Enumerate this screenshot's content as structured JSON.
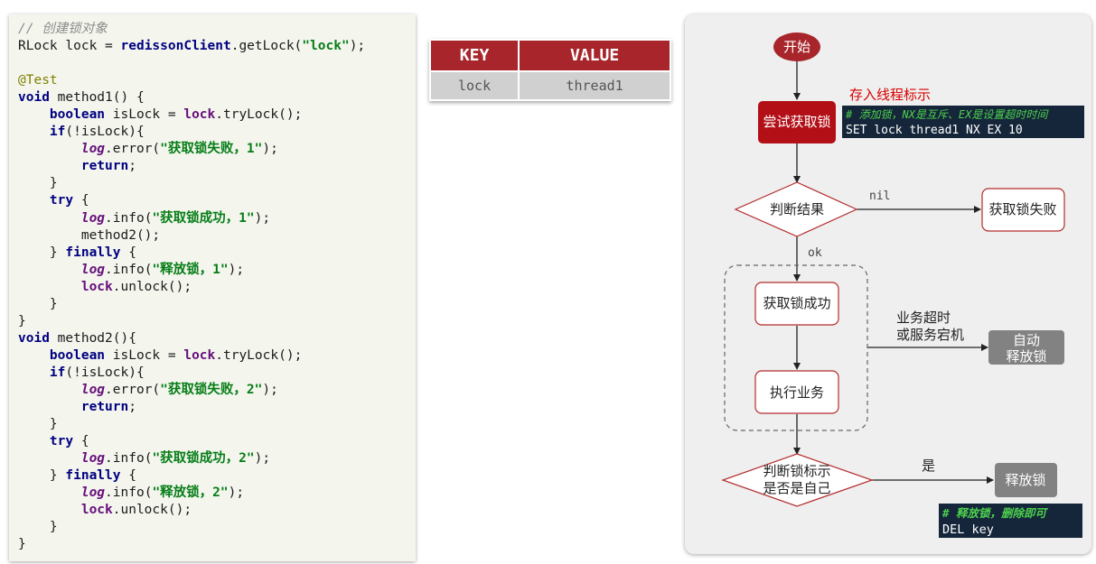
{
  "code": {
    "lines": [
      [
        [
          "// 创建锁对象",
          "comment"
        ]
      ],
      [
        [
          "RLock lock = ",
          "plain"
        ],
        [
          "redissonClient",
          "kw"
        ],
        [
          ".getLock(",
          "plain"
        ],
        [
          "\"lock\"",
          "str"
        ],
        [
          ");",
          "plain"
        ]
      ],
      [],
      [
        [
          "@Test",
          "ann"
        ]
      ],
      [
        [
          "void",
          "kw"
        ],
        [
          " method1() {",
          "plain"
        ]
      ],
      [
        [
          "    ",
          "plain"
        ],
        [
          "boolean",
          "kw"
        ],
        [
          " isLock = ",
          "plain"
        ],
        [
          "lock",
          "field"
        ],
        [
          ".tryLock();",
          "plain"
        ]
      ],
      [
        [
          "    ",
          "plain"
        ],
        [
          "if",
          "kw"
        ],
        [
          "(!isLock){",
          "plain"
        ]
      ],
      [
        [
          "        ",
          "plain"
        ],
        [
          "log",
          "static"
        ],
        [
          ".error(",
          "plain"
        ],
        [
          "\"获取锁失败，1\"",
          "str"
        ],
        [
          ");",
          "plain"
        ]
      ],
      [
        [
          "        ",
          "plain"
        ],
        [
          "return",
          "kw"
        ],
        [
          ";",
          "plain"
        ]
      ],
      [
        [
          "    }",
          "plain"
        ]
      ],
      [
        [
          "    ",
          "plain"
        ],
        [
          "try",
          "kw"
        ],
        [
          " {",
          "plain"
        ]
      ],
      [
        [
          "        ",
          "plain"
        ],
        [
          "log",
          "static"
        ],
        [
          ".info(",
          "plain"
        ],
        [
          "\"获取锁成功，1\"",
          "str"
        ],
        [
          ");",
          "plain"
        ]
      ],
      [
        [
          "        method2();",
          "plain"
        ]
      ],
      [
        [
          "    } ",
          "plain"
        ],
        [
          "finally",
          "kw"
        ],
        [
          " {",
          "plain"
        ]
      ],
      [
        [
          "        ",
          "plain"
        ],
        [
          "log",
          "static"
        ],
        [
          ".info(",
          "plain"
        ],
        [
          "\"释放锁，1\"",
          "str"
        ],
        [
          ");",
          "plain"
        ]
      ],
      [
        [
          "        ",
          "plain"
        ],
        [
          "lock",
          "field"
        ],
        [
          ".unlock();",
          "plain"
        ]
      ],
      [
        [
          "    }",
          "plain"
        ]
      ],
      [
        [
          "}",
          "plain"
        ]
      ],
      [
        [
          "void",
          "kw"
        ],
        [
          " method2(){",
          "plain"
        ]
      ],
      [
        [
          "    ",
          "plain"
        ],
        [
          "boolean",
          "kw"
        ],
        [
          " isLock = ",
          "plain"
        ],
        [
          "lock",
          "field"
        ],
        [
          ".tryLock();",
          "plain"
        ]
      ],
      [
        [
          "    ",
          "plain"
        ],
        [
          "if",
          "kw"
        ],
        [
          "(!isLock){",
          "plain"
        ]
      ],
      [
        [
          "        ",
          "plain"
        ],
        [
          "log",
          "static"
        ],
        [
          ".error(",
          "plain"
        ],
        [
          "\"获取锁失败，2\"",
          "str"
        ],
        [
          ");",
          "plain"
        ]
      ],
      [
        [
          "        ",
          "plain"
        ],
        [
          "return",
          "kw"
        ],
        [
          ";",
          "plain"
        ]
      ],
      [
        [
          "    }",
          "plain"
        ]
      ],
      [
        [
          "    ",
          "plain"
        ],
        [
          "try",
          "kw"
        ],
        [
          " {",
          "plain"
        ]
      ],
      [
        [
          "        ",
          "plain"
        ],
        [
          "log",
          "static"
        ],
        [
          ".info(",
          "plain"
        ],
        [
          "\"获取锁成功，2\"",
          "str"
        ],
        [
          ");",
          "plain"
        ]
      ],
      [
        [
          "    } ",
          "plain"
        ],
        [
          "finally",
          "kw"
        ],
        [
          " {",
          "plain"
        ]
      ],
      [
        [
          "        ",
          "plain"
        ],
        [
          "log",
          "static"
        ],
        [
          ".info(",
          "plain"
        ],
        [
          "\"释放锁，2\"",
          "str"
        ],
        [
          ");",
          "plain"
        ]
      ],
      [
        [
          "        ",
          "plain"
        ],
        [
          "lock",
          "field"
        ],
        [
          ".unlock();",
          "plain"
        ]
      ],
      [
        [
          "    }",
          "plain"
        ]
      ],
      [
        [
          "}",
          "plain"
        ]
      ]
    ]
  },
  "kv_table": {
    "key_header": "KEY",
    "value_header": "VALUE",
    "key": "lock",
    "value": "thread1"
  },
  "flow": {
    "start": "开始",
    "try_lock": "尝试获取锁",
    "store_label": "存入线程标示",
    "set_comment": "# 添加锁，NX是互斥、EX是设置超时时间",
    "set_command": "SET lock thread1 NX EX 10",
    "judge_result": "判断结果",
    "nil_label": "nil",
    "fail": "获取锁失败",
    "ok_label": "ok",
    "success": "获取锁成功",
    "execute": "执行业务",
    "timeout_line1": "业务超时",
    "timeout_line2": "或服务宕机",
    "auto_line1": "自动",
    "auto_line2": "释放锁",
    "judge_line1": "判断锁标示",
    "judge_line2": "是否是自己",
    "yes_label": "是",
    "release": "释放锁",
    "del_comment": "# 释放锁，删除即可",
    "del_command": "DEL key"
  },
  "colors": {
    "accent_red": "#a8262b",
    "node_border": "#b52c2c",
    "dark_box": "#15263a",
    "green_comment": "#4dd14d",
    "grey_node": "#828282"
  }
}
